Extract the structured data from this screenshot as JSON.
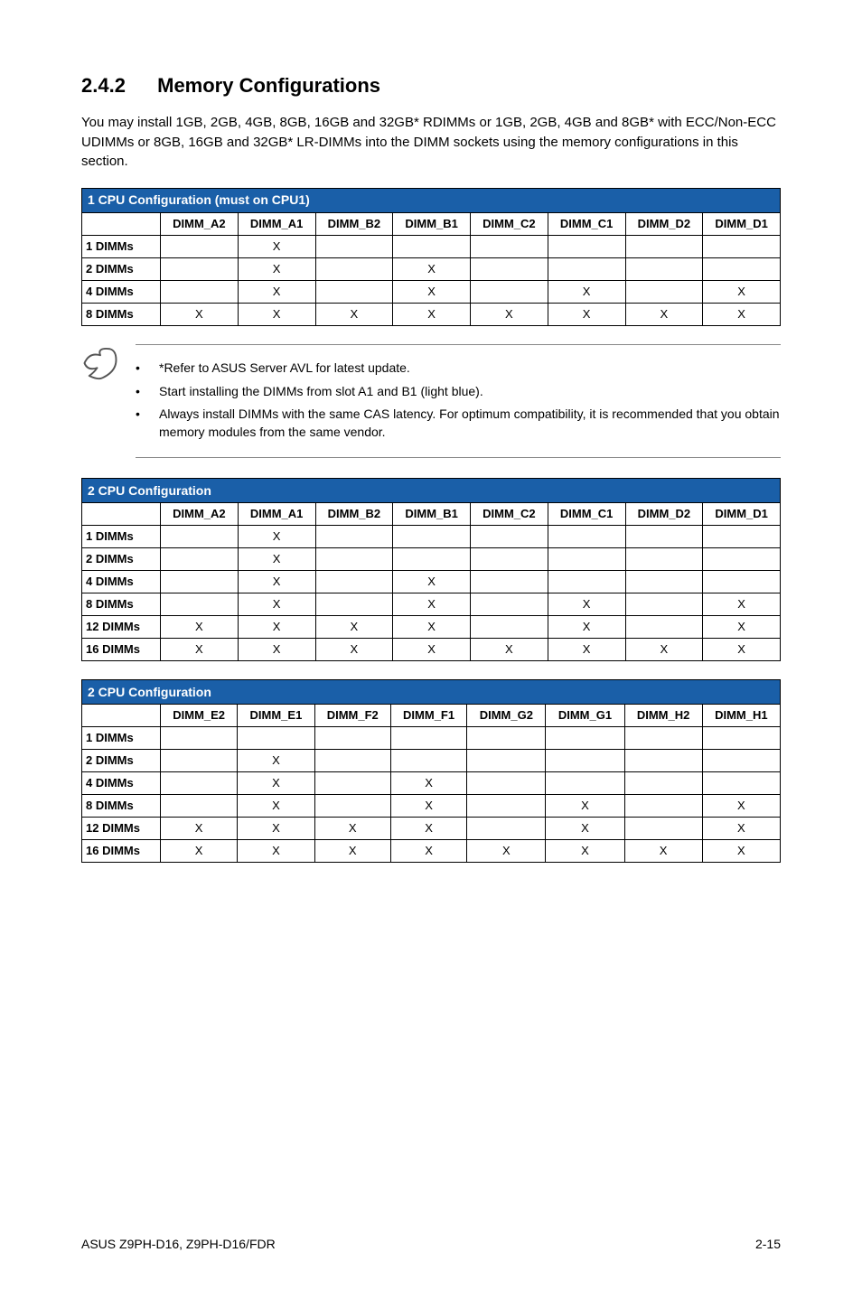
{
  "heading": {
    "number": "2.4.2",
    "title": "Memory Configurations"
  },
  "intro": "You may install 1GB, 2GB, 4GB, 8GB, 16GB and 32GB* RDIMMs or 1GB, 2GB, 4GB and 8GB* with ECC/Non-ECC UDIMMs or 8GB, 16GB and 32GB* LR-DIMMs into the DIMM sockets using the memory configurations in this section.",
  "table1": {
    "title": "1 CPU Configuration (must on CPU1)",
    "columns": [
      "DIMM_A2",
      "DIMM_A1",
      "DIMM_B2",
      "DIMM_B1",
      "DIMM_C2",
      "DIMM_C1",
      "DIMM_D2",
      "DIMM_D1"
    ],
    "rows": [
      {
        "label": "1 DIMMs",
        "cells": [
          "",
          "X",
          "",
          "",
          "",
          "",
          "",
          ""
        ]
      },
      {
        "label": "2 DIMMs",
        "cells": [
          "",
          "X",
          "",
          "X",
          "",
          "",
          "",
          ""
        ]
      },
      {
        "label": "4 DIMMs",
        "cells": [
          "",
          "X",
          "",
          "X",
          "",
          "X",
          "",
          "X"
        ]
      },
      {
        "label": "8 DIMMs",
        "cells": [
          "X",
          "X",
          "X",
          "X",
          "X",
          "X",
          "X",
          "X"
        ]
      }
    ]
  },
  "notes": [
    "*Refer to ASUS Server AVL for latest update.",
    "Start installing the DIMMs from slot A1 and B1 (light blue).",
    "Always install DIMMs with the same CAS latency. For optimum compatibility, it is recommended that you obtain memory modules from the same vendor."
  ],
  "table2": {
    "title": "2 CPU Configuration",
    "columns": [
      "DIMM_A2",
      "DIMM_A1",
      "DIMM_B2",
      "DIMM_B1",
      "DIMM_C2",
      "DIMM_C1",
      "DIMM_D2",
      "DIMM_D1"
    ],
    "rows": [
      {
        "label": "1 DIMMs",
        "cells": [
          "",
          "X",
          "",
          "",
          "",
          "",
          "",
          ""
        ]
      },
      {
        "label": "2 DIMMs",
        "cells": [
          "",
          "X",
          "",
          "",
          "",
          "",
          "",
          ""
        ]
      },
      {
        "label": "4 DIMMs",
        "cells": [
          "",
          "X",
          "",
          "X",
          "",
          "",
          "",
          ""
        ]
      },
      {
        "label": "8 DIMMs",
        "cells": [
          "",
          "X",
          "",
          "X",
          "",
          "X",
          "",
          "X"
        ]
      },
      {
        "label": "12 DIMMs",
        "cells": [
          "X",
          "X",
          "X",
          "X",
          "",
          "X",
          "",
          "X"
        ]
      },
      {
        "label": "16 DIMMs",
        "cells": [
          "X",
          "X",
          "X",
          "X",
          "X",
          "X",
          "X",
          "X"
        ]
      }
    ]
  },
  "table3": {
    "title": "2 CPU Configuration",
    "columns": [
      "DIMM_E2",
      "DIMM_E1",
      "DIMM_F2",
      "DIMM_F1",
      "DIMM_G2",
      "DIMM_G1",
      "DIMM_H2",
      "DIMM_H1"
    ],
    "rows": [
      {
        "label": "1 DIMMs",
        "cells": [
          "",
          "",
          "",
          "",
          "",
          "",
          "",
          ""
        ]
      },
      {
        "label": "2 DIMMs",
        "cells": [
          "",
          "X",
          "",
          "",
          "",
          "",
          "",
          ""
        ]
      },
      {
        "label": "4 DIMMs",
        "cells": [
          "",
          "X",
          "",
          "X",
          "",
          "",
          "",
          ""
        ]
      },
      {
        "label": "8 DIMMs",
        "cells": [
          "",
          "X",
          "",
          "X",
          "",
          "X",
          "",
          "X"
        ]
      },
      {
        "label": "12 DIMMs",
        "cells": [
          "X",
          "X",
          "X",
          "X",
          "",
          "X",
          "",
          "X"
        ]
      },
      {
        "label": "16 DIMMs",
        "cells": [
          "X",
          "X",
          "X",
          "X",
          "X",
          "X",
          "X",
          "X"
        ]
      }
    ]
  },
  "footer": {
    "left": "ASUS Z9PH-D16, Z9PH-D16/FDR",
    "right": "2-15"
  }
}
